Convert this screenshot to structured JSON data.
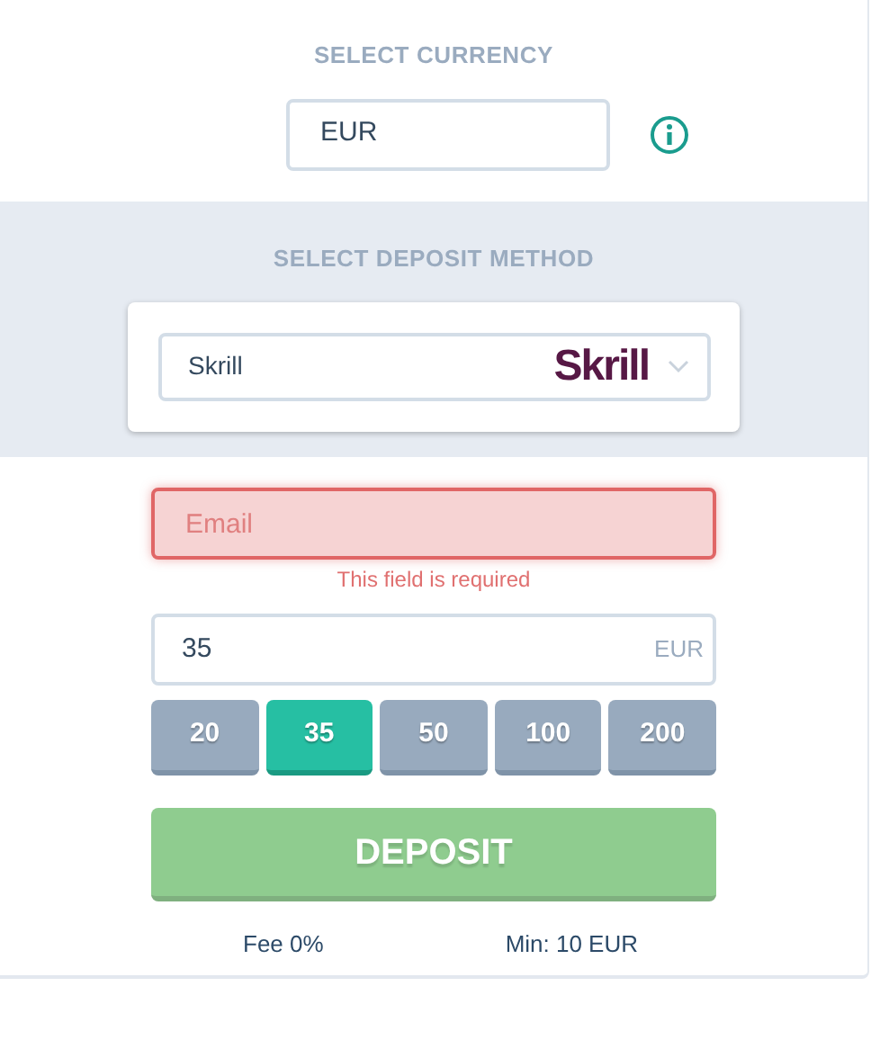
{
  "currency": {
    "title": "SELECT CURRENCY",
    "value": "EUR"
  },
  "deposit_method": {
    "title": "SELECT DEPOSIT METHOD",
    "value": "Skrill",
    "logo": "Skrill"
  },
  "email": {
    "placeholder": "Email",
    "invalid": true,
    "error": "This field is required"
  },
  "amount": {
    "value": "35",
    "unit": "EUR"
  },
  "presets": [
    {
      "label": "20",
      "selected": false
    },
    {
      "label": "35",
      "selected": true
    },
    {
      "label": "50",
      "selected": false
    },
    {
      "label": "100",
      "selected": false
    },
    {
      "label": "200",
      "selected": false
    }
  ],
  "deposit_button": {
    "label": "DEPOSIT",
    "disabled": true
  },
  "fee": "Fee 0%",
  "min": "Min: 10 EUR"
}
